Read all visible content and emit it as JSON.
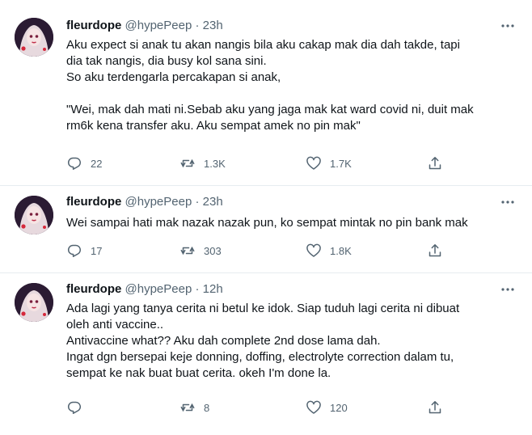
{
  "tweets": [
    {
      "name": "fleurdope",
      "handle": "@hypePeep",
      "separator": "·",
      "time": "23h",
      "lines": [
        "Aku expect si anak tu akan nangis bila aku cakap mak dia dah takde, tapi",
        "dia tak nangis, dia busy kol sana sini.",
        "So aku terdengarla percakapan si anak,",
        "",
        "\"Wei, mak dah mati ni.Sebab aku yang jaga mak kat ward covid ni, duit mak",
        "rm6k kena transfer aku. Aku sempat amek no pin mak\""
      ],
      "replies": "22",
      "retweets": "1.3K",
      "likes": "1.7K"
    },
    {
      "name": "fleurdope",
      "handle": "@hypePeep",
      "separator": "·",
      "time": "23h",
      "lines": [
        "Wei sampai hati mak nazak nazak pun, ko sempat mintak no pin bank mak"
      ],
      "replies": "17",
      "retweets": "303",
      "likes": "1.8K"
    },
    {
      "name": "fleurdope",
      "handle": "@hypePeep",
      "separator": "·",
      "time": "12h",
      "lines": [
        "Ada lagi yang tanya cerita ni betul ke idok. Siap tuduh lagi cerita ni dibuat",
        "oleh anti vaccine..",
        "Antivaccine what?? Aku dah complete 2nd dose lama dah.",
        "Ingat dgn bersepai keje donning, doffing, electrolyte correction dalam tu,",
        "sempat ke nak buat buat cerita. okeh I'm done la."
      ],
      "replies": "",
      "retweets": "8",
      "likes": "120"
    }
  ],
  "icons": {
    "reply": "reply-icon",
    "retweet": "retweet-icon",
    "like": "heart-icon",
    "share": "share-icon",
    "more": "more-icon"
  },
  "colors": {
    "text": "#0f1419",
    "muted": "#536471",
    "divider": "#e6ecf0"
  }
}
